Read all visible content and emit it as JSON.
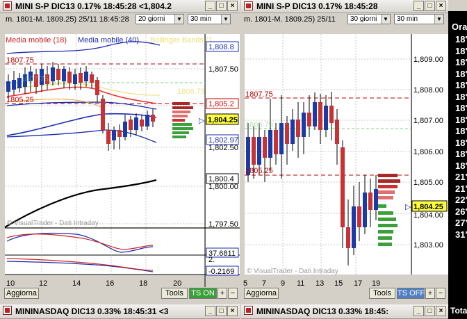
{
  "left_window": {
    "title": "MINI S-P DIC13 0.17% 18:45:28  <1,804.2",
    "contract": "m. 1801-M. 1809.25) 25/11 18:45:28",
    "period": "20 giorni",
    "timeframe": "30 min",
    "legend": {
      "ma18": "Media mobile (18)",
      "ma40": "Media mobile (40)",
      "bollinger": "Bollinger Bands (1"
    },
    "price_labels": [
      "1,808.8",
      "1,807.50",
      "1,805.2",
      "1,804.25",
      "1,802.97",
      "1,802.50",
      "1,800.4",
      "1,800.00",
      "1,797.50"
    ],
    "level_labels": [
      "1807.75",
      "1805.25",
      "1807.75",
      "1806.75"
    ],
    "watermark": "© VisualTrader - Dati Intraday",
    "osc1_value": "37.6811",
    "osc2_values": [
      "2.",
      "-0.2169"
    ],
    "xaxis": [
      "10",
      "12",
      "14",
      "16",
      "18",
      "20"
    ],
    "buttons": {
      "update": "Aggiorna",
      "tools": "Tools",
      "ts": "TS ON"
    }
  },
  "right_window": {
    "title": "MINI S-P DIC13 0.17% 18:45:28",
    "contract": "m. 1801-M. 1809.25) 25/11",
    "period": "30 giorni",
    "timeframe": "30 min",
    "price_labels": [
      "1,809.00",
      "1,808.00",
      "1,807.00",
      "1,806.00",
      "1,805.00",
      "1,804.25",
      "1,804.00",
      "1,803.00"
    ],
    "level_labels": [
      "1807.75",
      "1806.75",
      "1805.25"
    ],
    "watermark": "© VisualTrader - Dati Intraday",
    "xaxis": [
      "5",
      "7",
      "9",
      "11",
      "13",
      "15",
      "17",
      "19"
    ],
    "buttons": {
      "update": "Aggiorna",
      "tools": "Tools",
      "ts": "TS OFF"
    }
  },
  "bottom_left_title": "MININASDAQ DIC13 0.33% 18:45:31  <3",
  "bottom_right_title": "MININASDAQ DIC13 0.33% 18:45:",
  "quote_panel": {
    "header": "Ora",
    "rows": [
      "18'",
      "18'",
      "18'",
      "18'",
      "18'",
      "18'",
      "18'",
      "18'",
      "18'",
      "18'",
      "18'",
      "18'",
      "21'",
      "21'",
      "22'",
      "26'",
      "27'",
      "31'"
    ],
    "footer": "Tota"
  },
  "colors": {
    "up": "#1a3aa8",
    "down": "#c83232",
    "ts_on": "#3aa03a",
    "ts_off": "#4f7fc0"
  }
}
